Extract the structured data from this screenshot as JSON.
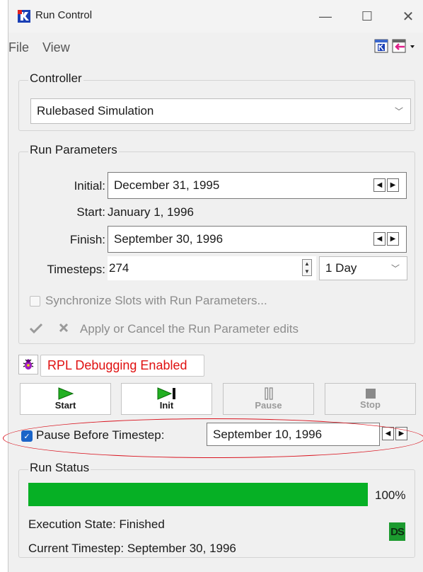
{
  "window": {
    "title": "Run Control"
  },
  "menu": {
    "file": "File",
    "view": "View"
  },
  "controller": {
    "group_title": "Controller",
    "selected": "Rulebased Simulation"
  },
  "run_parameters": {
    "group_title": "Run Parameters",
    "initial_label": "Initial:",
    "initial_value": "December 31, 1995",
    "start_label": "Start:",
    "start_value": "January 1, 1996",
    "finish_label": "Finish:",
    "finish_value": "September 30, 1996",
    "timesteps_label": "Timesteps:",
    "timesteps_value": "274",
    "timestep_unit": "1 Day",
    "sync_label": "Synchronize Slots with Run Parameters...",
    "apply_label": "Apply or Cancel the Run Parameter edits"
  },
  "debug": {
    "label": "RPL Debugging Enabled"
  },
  "buttons": {
    "start": "Start",
    "init": "Init",
    "pause": "Pause",
    "stop": "Stop"
  },
  "pause_before": {
    "label": "Pause Before Timestep:",
    "value": "September 10, 1996",
    "checked": true
  },
  "run_status": {
    "group_title": "Run Status",
    "progress": 100,
    "progress_text": "100%",
    "execution_state": "Execution State: Finished",
    "current_timestep": "Current Timestep: September 30, 1996",
    "ds_badge": "DS"
  },
  "colors": {
    "progress": "#06b025",
    "debug_text": "#e01010",
    "annotation_ellipse": "#d9141f",
    "play_green": "#22b022"
  }
}
